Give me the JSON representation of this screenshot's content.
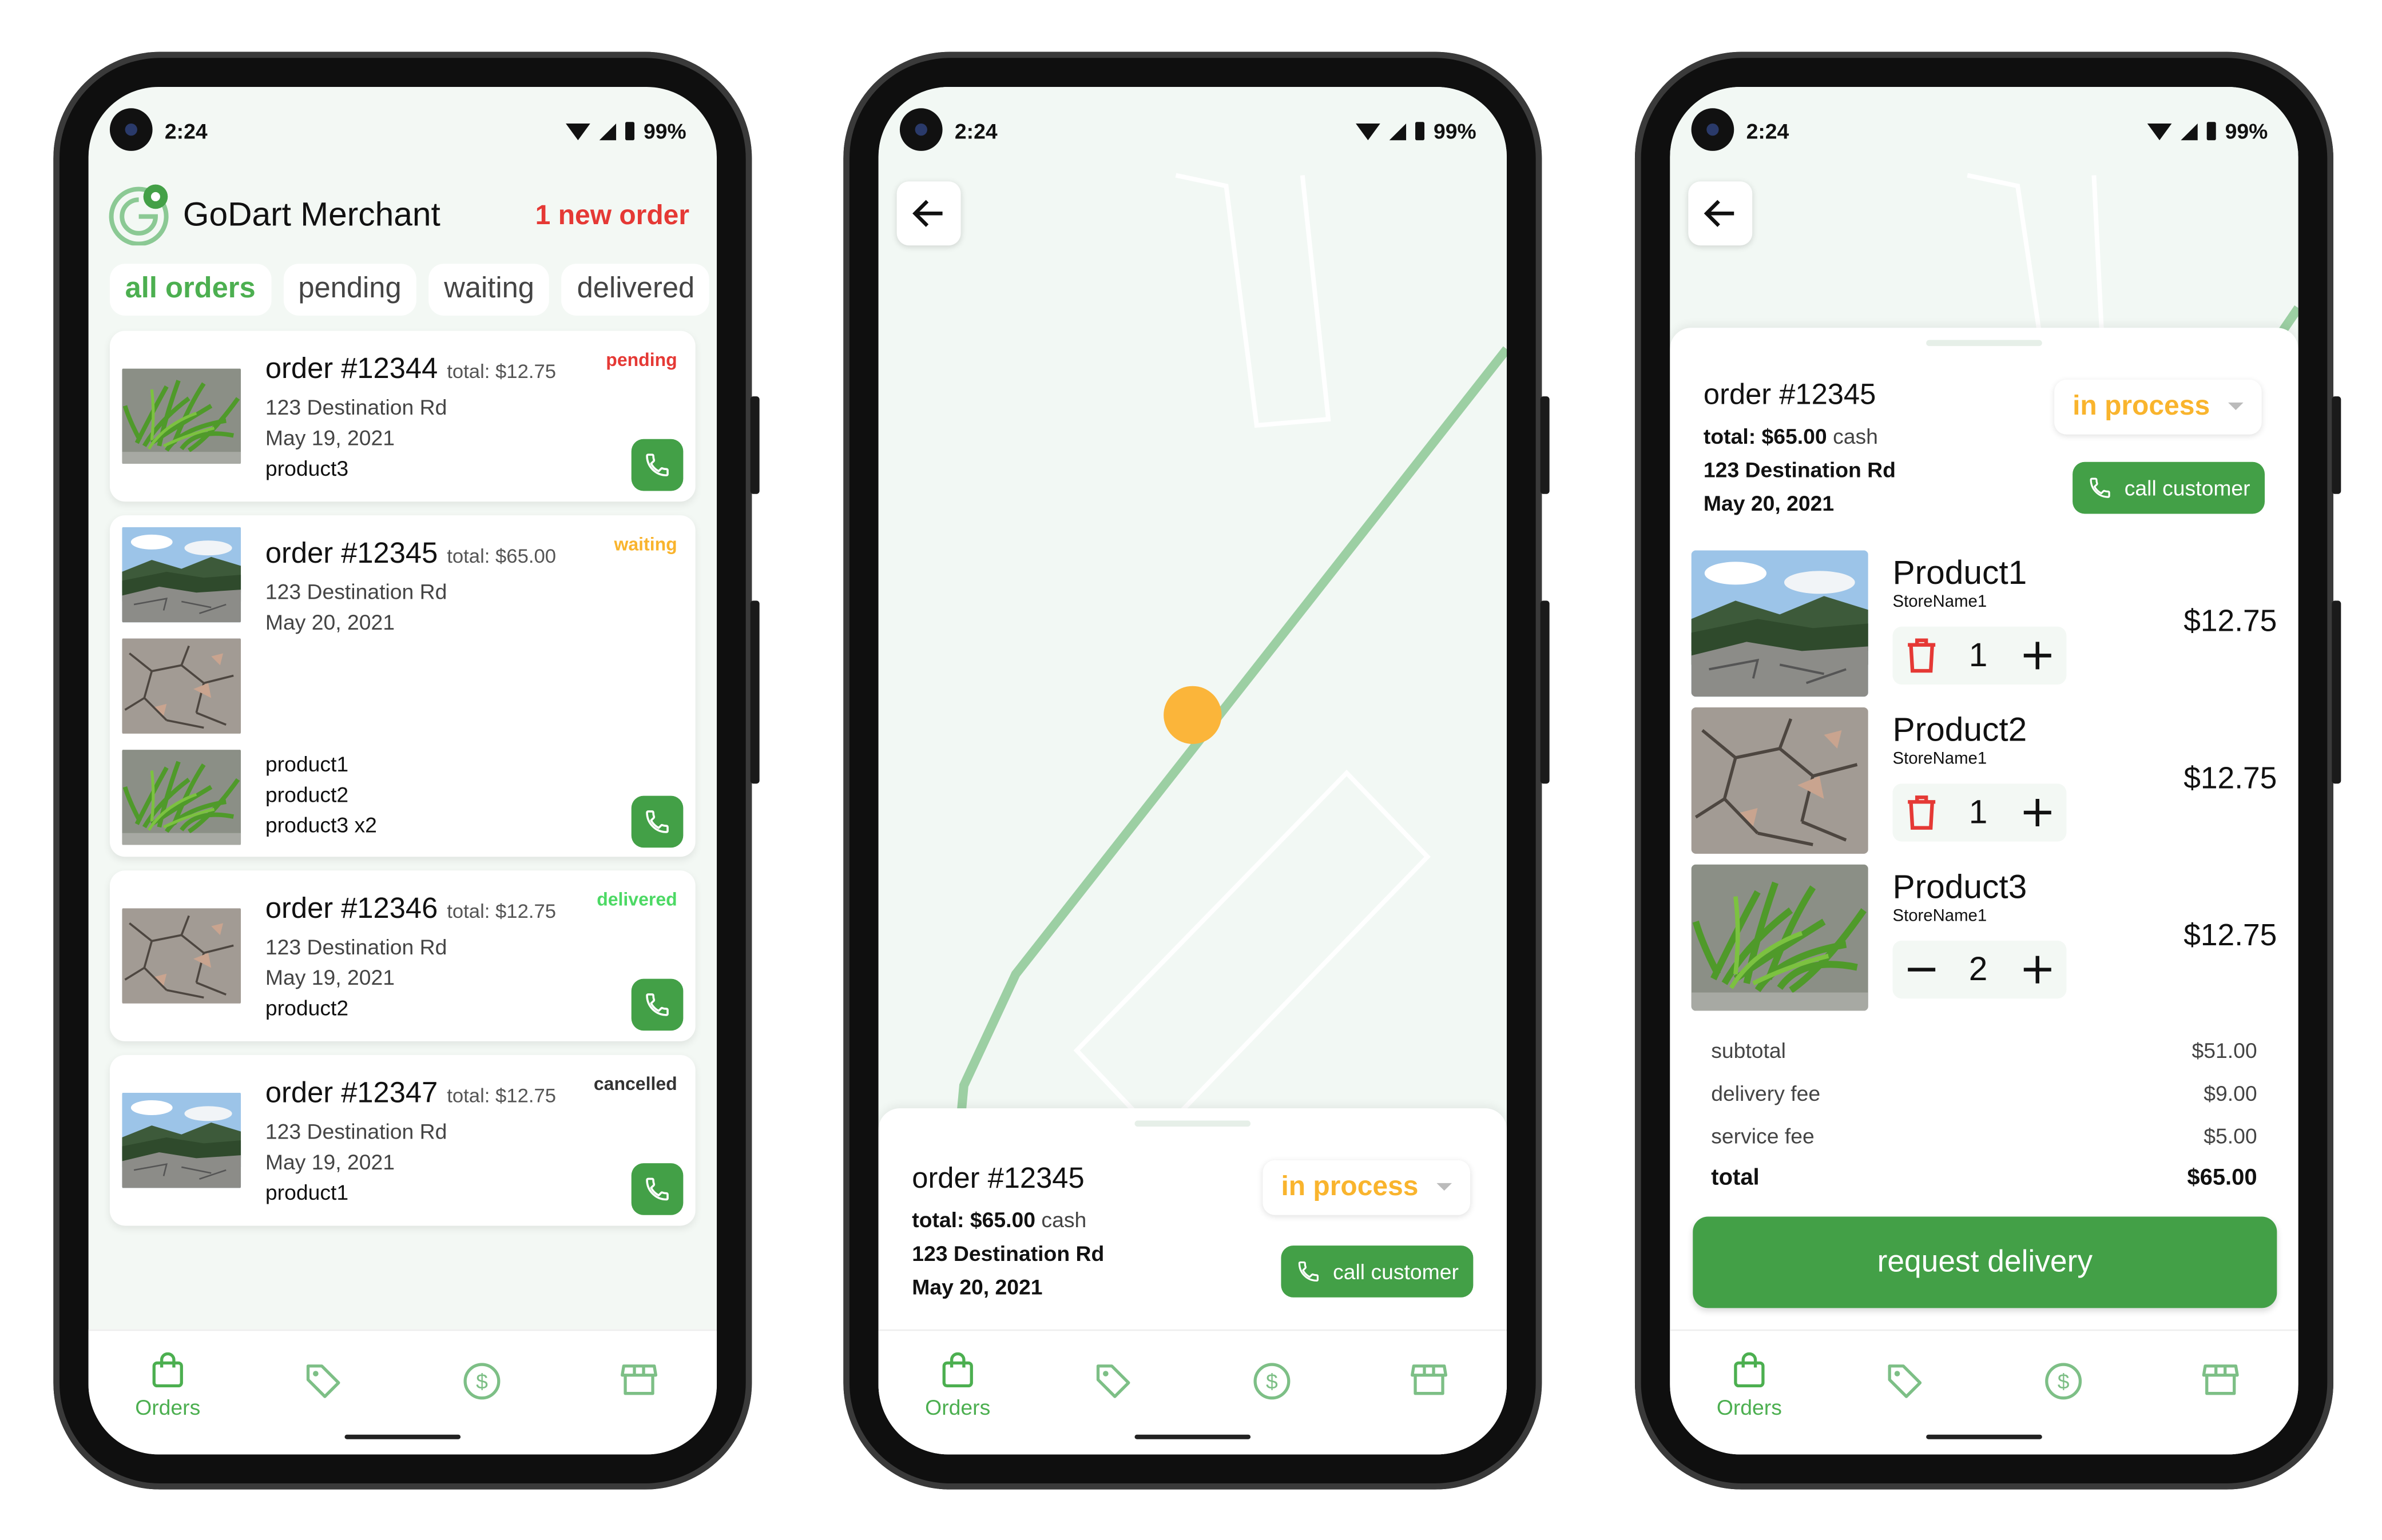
{
  "status_bar": {
    "time": "2:24",
    "battery": "99%"
  },
  "orders_screen": {
    "app_title": "GoDart Merchant",
    "new_order_alert": "1 new order",
    "filter_tabs": [
      "all orders",
      "pending",
      "waiting",
      "delivered"
    ],
    "orders": [
      {
        "number": "order #12344",
        "total": "total: $12.75",
        "status": "pending",
        "status_color": "#e53935",
        "address": "123 Destination Rd",
        "date": "May 19, 2021",
        "products": [
          "product3"
        ]
      },
      {
        "number": "order #12345",
        "total": "total: $65.00",
        "status": "waiting",
        "status_color": "#f9b42d",
        "address": "123 Destination Rd",
        "date": "May 20, 2021",
        "products": [
          "product1",
          "product2",
          "product3 x2"
        ]
      },
      {
        "number": "order #12346",
        "total": "total: $12.75",
        "status": "delivered",
        "status_color": "#4cd964",
        "address": "123 Destination Rd",
        "date": "May 19, 2021",
        "products": [
          "product2"
        ]
      },
      {
        "number": "order #12347",
        "total": "total: $12.75",
        "status": "cancelled",
        "status_color": "#333333",
        "address": "123 Destination Rd",
        "date": "May 19, 2021",
        "products": [
          "product1"
        ]
      }
    ]
  },
  "map_screen": {
    "order_number": "order #12345",
    "total_label": "total: $65.00",
    "payment_method": "cash",
    "address": "123 Destination Rd",
    "date": "May 20, 2021",
    "status_select": "in process",
    "call_customer": "call customer"
  },
  "detail_screen": {
    "order_number": "order #12345",
    "total_label": "total: $65.00",
    "payment_method": "cash",
    "address": "123 Destination Rd",
    "date": "May 20, 2021",
    "status_select": "in process",
    "call_customer": "call customer",
    "items": [
      {
        "name": "Product1",
        "store": "StoreName1",
        "qty": "1",
        "price": "$12.75",
        "left_control": "trash"
      },
      {
        "name": "Product2",
        "store": "StoreName1",
        "qty": "1",
        "price": "$12.75",
        "left_control": "trash"
      },
      {
        "name": "Product3",
        "store": "StoreName1",
        "qty": "2",
        "price": "$12.75",
        "left_control": "minus"
      }
    ],
    "summary": {
      "subtotal_label": "subtotal",
      "subtotal": "$51.00",
      "delivery_label": "delivery fee",
      "delivery": "$9.00",
      "service_label": "service fee",
      "service": "$5.00",
      "total_label": "total",
      "total": "$65.00"
    },
    "request_button": "request delivery"
  },
  "nav": {
    "orders_label": "Orders",
    "icons": [
      "bag-icon",
      "tag-icon",
      "dollar-icon",
      "store-icon"
    ]
  },
  "colors": {
    "primary": "#43a047",
    "accent_orange": "#f9b42d",
    "alert_red": "#e53935",
    "background": "#f3f8f4",
    "map_route": "#9ccfa3"
  }
}
